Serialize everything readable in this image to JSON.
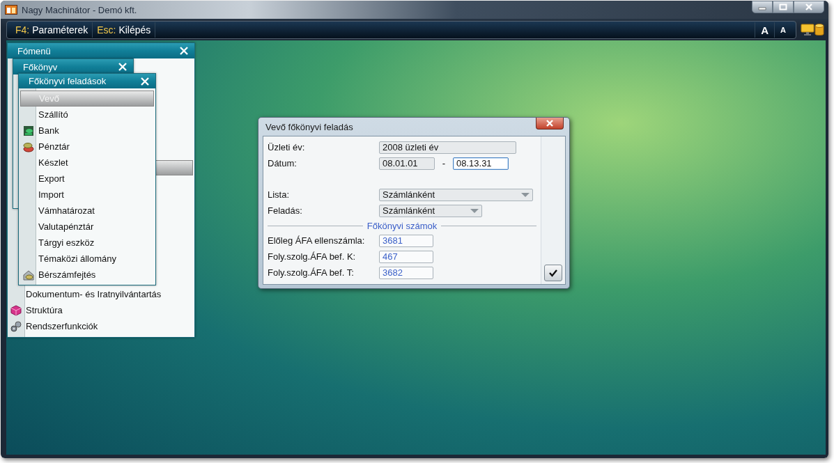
{
  "window": {
    "title": "Nagy Machinátor - Demó kft."
  },
  "toolbar": {
    "commands": [
      {
        "key": "F4:",
        "label": "Paraméterek"
      },
      {
        "key": "Esc:",
        "label": "Kilépés"
      }
    ],
    "font_buttons": [
      {
        "label": "A",
        "kind": "larger"
      },
      {
        "label": "A",
        "kind": "smaller"
      }
    ]
  },
  "main_menu": {
    "title": "Fómenü",
    "items": [
      {
        "label": "Dokumentum- és Iratnyilvántartás",
        "kind": "text"
      },
      {
        "label": "Struktúra",
        "kind": "cube"
      },
      {
        "label": "Rendszerfunkciók",
        "kind": "gears"
      }
    ]
  },
  "ledger_menu": {
    "title": "Főkönyv"
  },
  "tasks_menu": {
    "title": "Főkönyvi feladások",
    "items": [
      {
        "label": "Vevő",
        "kind": "text",
        "selected": true
      },
      {
        "label": "Szállító",
        "kind": "text",
        "selected": false
      },
      {
        "label": "Bank",
        "kind": "bank",
        "selected": false
      },
      {
        "label": "Pénztár",
        "kind": "coins",
        "selected": false
      },
      {
        "label": "Készlet",
        "kind": "text",
        "selected": false
      },
      {
        "label": "Export",
        "kind": "text",
        "selected": false
      },
      {
        "label": "Import",
        "kind": "text",
        "selected": false
      },
      {
        "label": "Vámhatározat",
        "kind": "text",
        "selected": false
      },
      {
        "label": "Valutapénztár",
        "kind": "text",
        "selected": false
      },
      {
        "label": "Tárgyi eszköz",
        "kind": "text",
        "selected": false
      },
      {
        "label": "Témaközi állomány",
        "kind": "text",
        "selected": false
      },
      {
        "label": "Bérszámfejtés",
        "kind": "payroll",
        "selected": false
      }
    ]
  },
  "dialog": {
    "title": "Vevő főkönyvi feladás",
    "year": {
      "label": "Üzleti év:",
      "value": "2008 üzleti év",
      "readonly": true
    },
    "date": {
      "label": "Dátum:",
      "from": {
        "value": "08.01.01",
        "readonly": true
      },
      "separator": "-",
      "to": {
        "value": "08.13.31",
        "readonly": false
      }
    },
    "options": [
      {
        "label": "Lista:",
        "value": "Számlánként"
      },
      {
        "label": "Feladás:",
        "value": "Számlánként"
      }
    ],
    "accounts": {
      "title": "Főkönyvi számok",
      "fields": [
        {
          "label": "Előleg ÁFA ellenszámla:",
          "value": "3681"
        },
        {
          "label": "Foly.szolg.ÁFA bef. K:",
          "value": "467"
        },
        {
          "label": "Foly.szolg.ÁFA bef. T:",
          "value": "3682"
        }
      ]
    }
  }
}
